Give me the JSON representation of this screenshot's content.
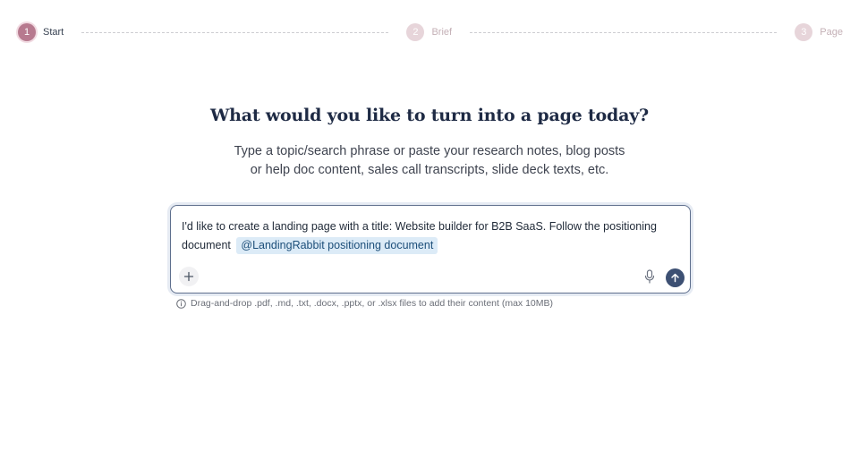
{
  "stepper": {
    "steps": [
      {
        "number": "1",
        "label": "Start",
        "state": "active"
      },
      {
        "number": "2",
        "label": "Brief",
        "state": "inactive"
      },
      {
        "number": "3",
        "label": "Page",
        "state": "inactive"
      }
    ]
  },
  "headline": "What would you like to turn into a page today?",
  "subtext": {
    "line1": "Type a topic/search phrase or paste your research notes, blog posts",
    "line2": "or help doc content, sales call transcripts, slide deck texts, etc."
  },
  "prompt": {
    "text": "I'd like to create a landing page with a title: Website builder for B2B SaaS. Follow the positioning document",
    "mention": "@LandingRabbit positioning document"
  },
  "hint": "Drag-and-drop .pdf, .md, .txt, .docx, .pptx, or .xlsx files to add their content (max 10MB)",
  "icons": {
    "add": "plus-icon",
    "mic": "microphone-icon",
    "send": "arrow-up-icon",
    "info": "info-icon"
  },
  "colors": {
    "accent": "#b77a8f",
    "send_button": "#3d5073",
    "mention_bg": "#dcebf7",
    "heading": "#1e2a44"
  }
}
